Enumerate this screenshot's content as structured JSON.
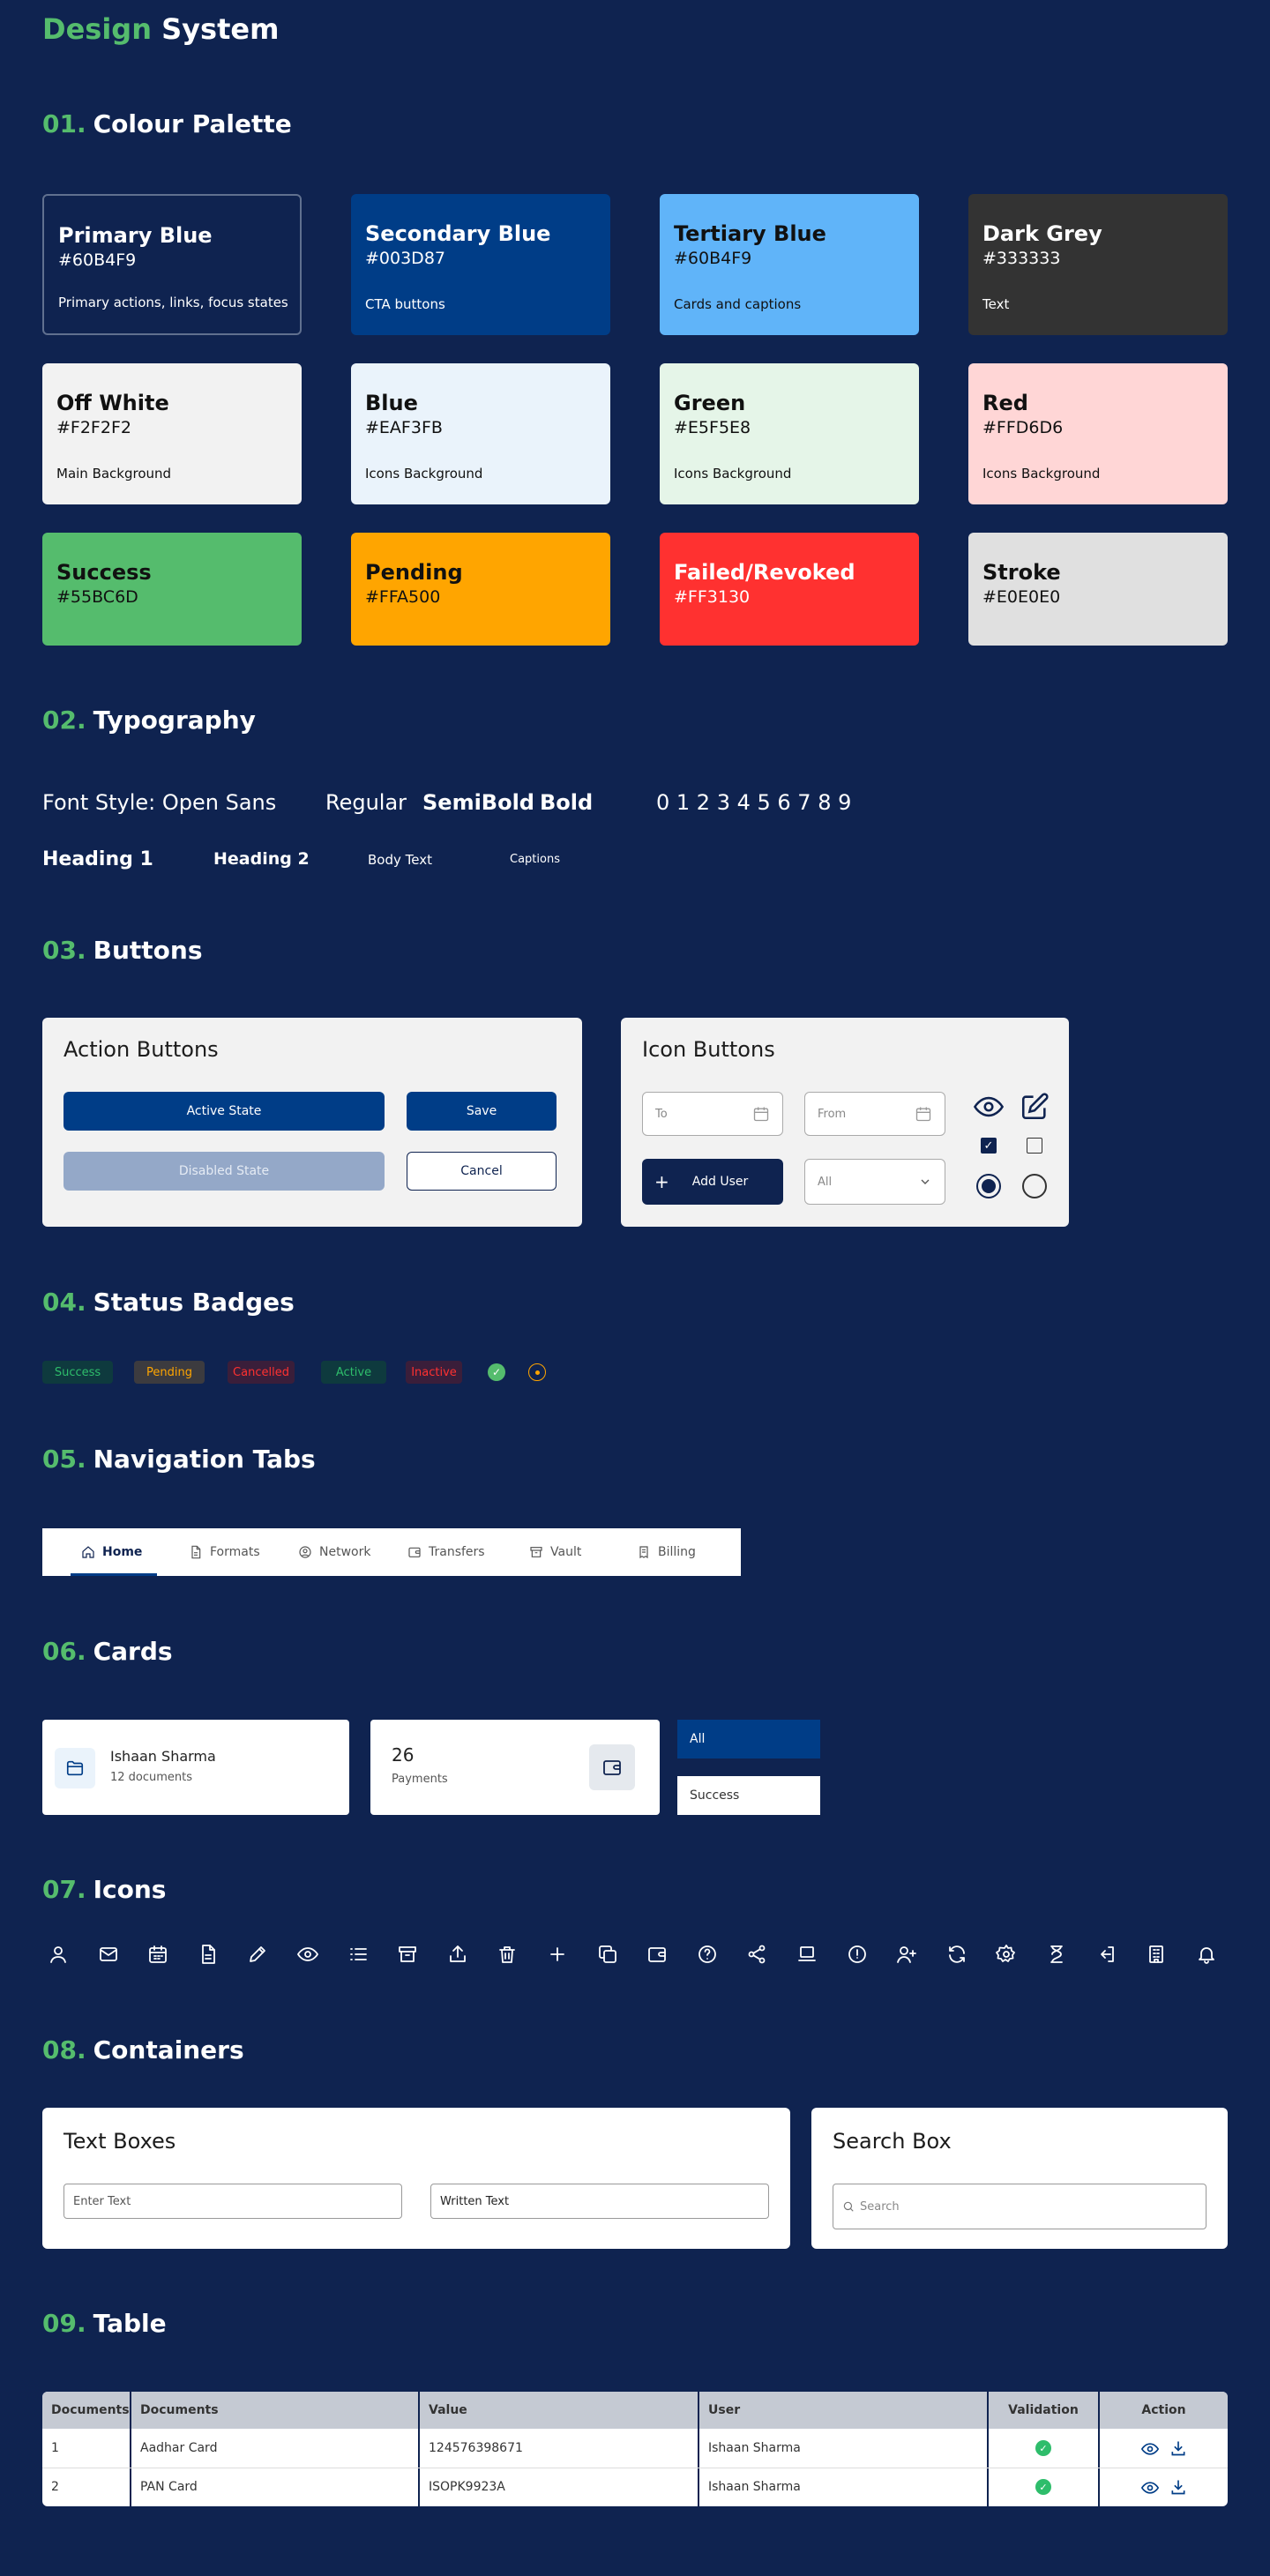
{
  "header": {
    "title_a": "Design",
    "title_b": "System"
  },
  "sections": [
    {
      "num": "01.",
      "title": "Colour Palette"
    },
    {
      "num": "02.",
      "title": "Typography"
    },
    {
      "num": "03.",
      "title": "Buttons"
    },
    {
      "num": "04.",
      "title": "Status Badges"
    },
    {
      "num": "05.",
      "title": "Navigation Tabs"
    },
    {
      "num": "06.",
      "title": "Cards"
    },
    {
      "num": "07.",
      "title": "Icons"
    },
    {
      "num": "08.",
      "title": "Containers"
    },
    {
      "num": "09.",
      "title": "Table"
    }
  ],
  "palette": [
    {
      "name": "Primary Blue",
      "hex": "#60B4F9",
      "desc": "Primary actions, links, focus states",
      "bg": "#0F2350",
      "fg": "#FFFFFF",
      "border": "#60708f"
    },
    {
      "name": "Secondary Blue",
      "hex": "#003D87",
      "desc": "CTA buttons",
      "bg": "#003D87",
      "fg": "#FFFFFF"
    },
    {
      "name": "Tertiary Blue",
      "hex": "#60B4F9",
      "desc": "Cards and captions",
      "bg": "#60B4F9",
      "fg": "#111111"
    },
    {
      "name": "Dark Grey",
      "hex": "#333333",
      "desc": "Text",
      "bg": "#333333",
      "fg": "#FFFFFF"
    },
    {
      "name": "Off White",
      "hex": "#F2F2F2",
      "desc": "Main Background",
      "bg": "#F2F2F2",
      "fg": "#111111"
    },
    {
      "name": "Blue",
      "hex": "#EAF3FB",
      "desc": "Icons Background",
      "bg": "#EAF3FB",
      "fg": "#111111"
    },
    {
      "name": "Green",
      "hex": "#E5F5E8",
      "desc": "Icons Background",
      "bg": "#E5F5E8",
      "fg": "#111111"
    },
    {
      "name": "Red",
      "hex": "#FFD6D6",
      "desc": "Icons Background",
      "bg": "#FFD6D6",
      "fg": "#111111"
    },
    {
      "name": "Success",
      "hex": "#55BC6D",
      "desc": "",
      "bg": "#55BC6D",
      "fg": "#111111"
    },
    {
      "name": "Pending",
      "hex": "#FFA500",
      "desc": "",
      "bg": "#FFA500",
      "fg": "#111111"
    },
    {
      "name": "Failed/Revoked",
      "hex": "#FF3130",
      "desc": "",
      "bg": "#FF3130",
      "fg": "#FFFFFF"
    },
    {
      "name": "Stroke",
      "hex": "#E0E0E0",
      "desc": "",
      "bg": "#E0E0E0",
      "fg": "#111111"
    }
  ],
  "typography": {
    "font_style": "Font Style: Open Sans",
    "regular": "Regular",
    "semibold": "SemiBold",
    "bold": "Bold",
    "digits": "0 1 2 3 4 5 6 7 8 9",
    "h1": "Heading 1",
    "h2": "Heading 2",
    "body": "Body Text",
    "captions": "Captions"
  },
  "buttons": {
    "action_title": "Action Buttons",
    "active": "Active State",
    "save": "Save",
    "disabled": "Disabled State",
    "cancel": "Cancel",
    "icon_title": "Icon Buttons",
    "to": "To",
    "from": "From",
    "add_user": "Add User",
    "all": "All"
  },
  "badges": [
    {
      "label": "Success",
      "fg": "#2EBD6B",
      "bg": "#0E3A3E"
    },
    {
      "label": "Pending",
      "fg": "#FFA500",
      "bg": "#3C3B3F"
    },
    {
      "label": "Cancelled",
      "fg": "#FF3130",
      "bg": "#3A1E3A"
    },
    {
      "label": "Active",
      "fg": "#2EBD6B",
      "bg": "#0E3A3E"
    },
    {
      "label": "Inactive",
      "fg": "#FF3130",
      "bg": "#3A1E3A"
    }
  ],
  "nav_tabs": [
    {
      "label": "Home",
      "icon": "home-icon"
    },
    {
      "label": "Formats",
      "icon": "document-icon"
    },
    {
      "label": "Network",
      "icon": "user-circle-icon"
    },
    {
      "label": "Transfers",
      "icon": "wallet-icon"
    },
    {
      "label": "Vault",
      "icon": "archive-icon"
    },
    {
      "label": "Billing",
      "icon": "receipt-icon"
    }
  ],
  "cards": {
    "user_name": "Ishaan Sharma",
    "user_docs": "12 documents",
    "payments_count": "26",
    "payments_label": "Payments",
    "filter_all": "All",
    "filter_success": "Success"
  },
  "icons": [
    "user-icon",
    "mail-icon",
    "calendar-icon",
    "document-icon",
    "pencil-icon",
    "eye-icon",
    "list-icon",
    "archive-icon",
    "share-upload-icon",
    "trash-icon",
    "plus-icon",
    "copy-icon",
    "wallet-icon",
    "help-icon",
    "share-icon",
    "laptop-icon",
    "alert-icon",
    "add-user-icon",
    "refresh-icon",
    "settings-icon",
    "hourglass-icon",
    "logout-icon",
    "building-icon",
    "bell-icon"
  ],
  "containers": {
    "textbox_title": "Text Boxes",
    "enter_text": "Enter Text",
    "written_text": "Written Text",
    "search_title": "Search Box",
    "search_placeholder": "Search"
  },
  "table": {
    "headers": [
      "Documents",
      "Documents",
      "Value",
      "User",
      "Validation",
      "Action"
    ],
    "rows": [
      {
        "num": "1",
        "doc": "Aadhar Card",
        "value": "124576398671",
        "user": "Ishaan Sharma"
      },
      {
        "num": "2",
        "doc": "PAN Card",
        "value": "ISOPK9923A",
        "user": "Ishaan Sharma"
      }
    ]
  }
}
